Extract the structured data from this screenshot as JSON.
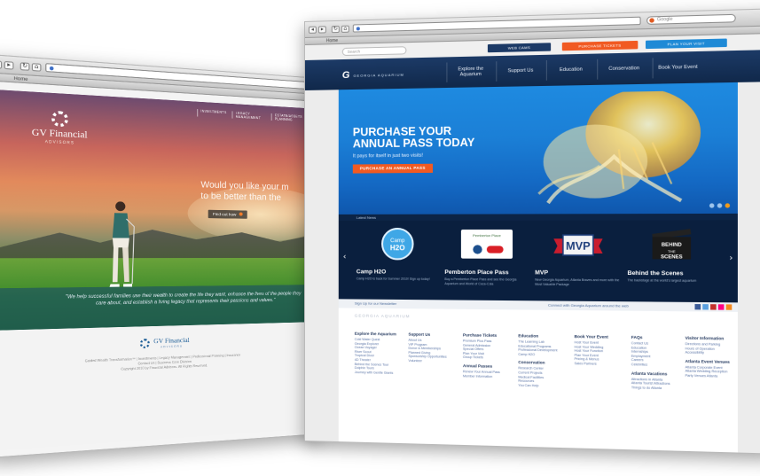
{
  "left_site": {
    "tab_label": "Home",
    "brand_name": "GV Financial",
    "brand_sub": "ADVISORS",
    "nav": [
      "INVESTMENTS",
      "LEGACY MANAGEMENT",
      "ESTATE/ASSETS PLANNING"
    ],
    "headline_line1": "Would you like your m",
    "headline_line2": "to be better than the",
    "find_out_label": "Find out how",
    "quote": "\"We help successful families use their wealth to create the life they want, enhance the lives of the people they care about, and establish a living legacy that represents their passions and values.\"",
    "footer_brand": "GV Financial",
    "footer_sub": "ADVISORS",
    "footer_line1": "Guided Wealth Transformation™ | Investments | Legacy Management | Professional Planning | Insurance",
    "footer_line2": "Contact Us | Business Care Division",
    "footer_line3": "Copyright 2010 by Financial Advisors. All Rights Reserved."
  },
  "right_site": {
    "tab_label": "Home",
    "google_placeholder": "Google",
    "search_placeholder": "Search",
    "util_buttons": [
      {
        "label": "WEB CAMS",
        "color": "#1c3a66"
      },
      {
        "label": "PURCHASE TICKETS",
        "color": "#f15a22"
      },
      {
        "label": "PLAN YOUR VISIT",
        "color": "#1f8ad6"
      }
    ],
    "logo_mark": "G",
    "logo_text": "GEORGIA AQUARIUM",
    "nav": [
      "Explore the Aquarium",
      "Support Us",
      "Education",
      "Conservation",
      "Book Your Event"
    ],
    "hero_title_line1": "PURCHASE YOUR",
    "hero_title_line2": "ANNUAL PASS TODAY",
    "hero_sub": "It pays for itself in just two visits!",
    "hero_button": "PURCHASE AN ANNUAL PASS",
    "featured_label": "Latest News",
    "cards": [
      {
        "title": "Camp H2O",
        "desc": "Camp H2O is back for Summer 2010! Sign up today!",
        "badge": "Camp H2O"
      },
      {
        "title": "Pemberton Place Pass",
        "desc": "Buy a Pemberton Place Pass and see the Georgia Aquarium and World of Coca-Cola",
        "badge": "Pemberton Place"
      },
      {
        "title": "MVP",
        "desc": "New Georgia Aquarium, Atlanta Braves and more with the Most Valuable Package",
        "badge": "MVP"
      },
      {
        "title": "Behind the Scenes",
        "desc": "The backstage at the world's largest aquarium",
        "badge": "BEHIND THE SCENES"
      }
    ],
    "social_left": "Sign Up for our Newsletter",
    "social_right": "Connect with Georgia Aquarium around the web",
    "footer_logo": "GEORGIA AQUARIUM",
    "footer_cols": [
      {
        "heading": "Explore the Aquarium",
        "items": [
          "Cold Water Quest",
          "Georgia Explorer",
          "Ocean Voyager",
          "River Scout",
          "Tropical Diver",
          "4D Theater",
          "Behind the Scenes Tour",
          "Dolphin Tours",
          "Journey with Gentle Giants"
        ]
      },
      {
        "heading": "Support Us",
        "items": [
          "About Us",
          "VIP Program",
          "Donor & Memberships",
          "Planned Giving",
          "Sponsorship Opportunities",
          "Volunteer"
        ],
        "heading2": "Annual Passes",
        "items2": [
          "Renew Your Annual Pass",
          "Member Information"
        ]
      },
      {
        "heading": "Purchase Tickets",
        "items": [
          "Premium Plus Pass",
          "General Admission",
          "Special Offers",
          "Plan Your Visit",
          "Group Tickets"
        ],
        "heading2": "Conservation",
        "items2": [
          "Research Center",
          "Current Projects",
          "Medical Facilities",
          "Resources",
          "You Can Help"
        ]
      },
      {
        "heading": "Education",
        "items": [
          "The Learning Lab",
          "Educational Programs",
          "Professional Development",
          "Camp H2O"
        ]
      },
      {
        "heading": "Book Your Event",
        "items": [
          "Host Your Event",
          "Host Your Wedding",
          "Host Your Function",
          "Plan Your Event",
          "Pricing & Menus",
          "Sales Partners"
        ]
      },
      {
        "heading": "FAQs",
        "items": [
          "Contact Us",
          "Education",
          "Internships",
          "Employment",
          "Careers",
          "Celebrities"
        ],
        "heading2": "Atlanta Vacations",
        "items2": [
          "Attractions in Atlanta",
          "Atlanta Tourist Attractions",
          "Things to do Atlanta"
        ]
      },
      {
        "heading": "Visitor Information",
        "items": [
          "Directions and Parking",
          "Hours of Operation",
          "Accessibility"
        ],
        "heading2": "Atlanta Event Venues",
        "items2": [
          "Atlanta Corporate Event",
          "Atlanta Wedding Reception",
          "Party Venues Atlanta"
        ]
      }
    ]
  }
}
